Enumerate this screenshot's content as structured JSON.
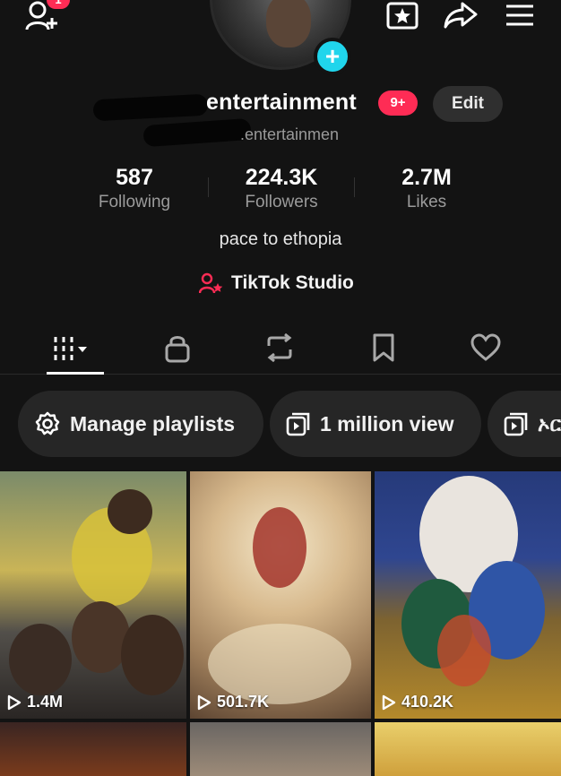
{
  "top_bar": {
    "add_friend_icon": "person-add-icon",
    "notification_count": "1",
    "favorites_icon": "star-box-icon",
    "share_icon": "share-arrow-icon",
    "menu_icon": "hamburger-menu-icon"
  },
  "profile": {
    "display_name": "entertainment",
    "badge": "9+",
    "edit_label": "Edit",
    "handle": ".entertainmen",
    "avatar_plus": "+"
  },
  "stats": [
    {
      "value": "587",
      "label": "Following"
    },
    {
      "value": "224.3K",
      "label": "Followers"
    },
    {
      "value": "2.7M",
      "label": "Likes"
    }
  ],
  "bio": "pace to ethopia",
  "studio": {
    "label": "TikTok Studio",
    "icon": "person-star-icon"
  },
  "tabs": [
    {
      "icon": "grid-icon",
      "active": true
    },
    {
      "icon": "lock-icon",
      "active": false
    },
    {
      "icon": "repost-icon",
      "active": false
    },
    {
      "icon": "bookmark-icon",
      "active": false
    },
    {
      "icon": "heart-icon",
      "active": false
    }
  ],
  "chips": [
    {
      "label": "Manage playlists",
      "icon": "gear-icon"
    },
    {
      "label": "1 million  view",
      "icon": "playlist-icon"
    },
    {
      "label": "ኦር",
      "icon": "playlist-icon"
    }
  ],
  "videos": [
    {
      "views": "1.4M"
    },
    {
      "views": "501.7K"
    },
    {
      "views": "410.2K"
    }
  ],
  "colors": {
    "background": "#131313",
    "accent_red": "#fe2c55",
    "accent_cyan": "#20d5ec",
    "chip_bg": "#262626"
  }
}
